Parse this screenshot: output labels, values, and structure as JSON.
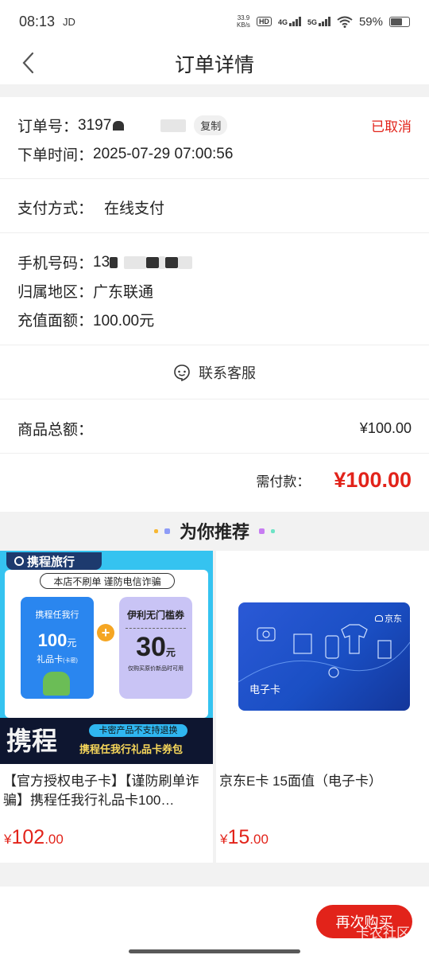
{
  "status_bar": {
    "time": "08:13",
    "carrier_icon": "JD",
    "speed_top": "33.9",
    "speed_bottom": "KB/s",
    "hd": "HD",
    "net1": "4G",
    "net2": "5G",
    "battery": "59%"
  },
  "nav": {
    "title": "订单详情"
  },
  "order": {
    "number_label": "订单号：",
    "number_value": "3197",
    "copy_label": "复制",
    "status": "已取消",
    "time_label": "下单时间：",
    "time_value": "2025-07-29 07:00:56"
  },
  "payment": {
    "label": "支付方式：",
    "value": "在线支付"
  },
  "recharge": {
    "phone_label": "手机号码：",
    "phone_value": "13",
    "region_label": "归属地区：",
    "region_value": "广东联通",
    "amount_label": "充值面额：",
    "amount_value": "100.00元"
  },
  "contact": {
    "label": "联系客服"
  },
  "totals": {
    "goods_label": "商品总额：",
    "goods_value": "¥100.00",
    "pay_label": "需付款：",
    "pay_value": "¥100.00"
  },
  "recommend": {
    "title": "为你推荐",
    "items": [
      {
        "name": "【官方授权电子卡】【谨防刷单诈骗】携程任我行礼品卡100…",
        "price_symbol": "¥",
        "price_int": "102",
        "price_dec": ".00",
        "banner": {
          "brand": "携程旅行",
          "warning": "本店不刷单 谨防电信诈骗",
          "card_title": "携程任我行",
          "card_amount": "100",
          "card_unit": "元",
          "card_type": "礼品卡",
          "card_type_small": "(卡密)",
          "coupon_title": "伊利无门槛券",
          "coupon_amount": "30",
          "coupon_unit": "元",
          "coupon_note": "仅购买原价新品时可用",
          "big_text": "携程",
          "notice": "卡密产品不支持退换",
          "package": "携程任我行礼品卡券包"
        }
      },
      {
        "name": "京东E卡 15面值（电子卡）",
        "price_symbol": "¥",
        "price_int": "15",
        "price_dec": ".00",
        "card": {
          "brand": "京东",
          "label": "电子卡"
        }
      }
    ]
  },
  "actions": {
    "buy_again": "再次购买"
  },
  "watermark": "卡农社区",
  "colors": {
    "accent_red": "#e2231a",
    "jd_blue": "#1a4fc4",
    "ctrip_blue": "#2f8cf0"
  }
}
